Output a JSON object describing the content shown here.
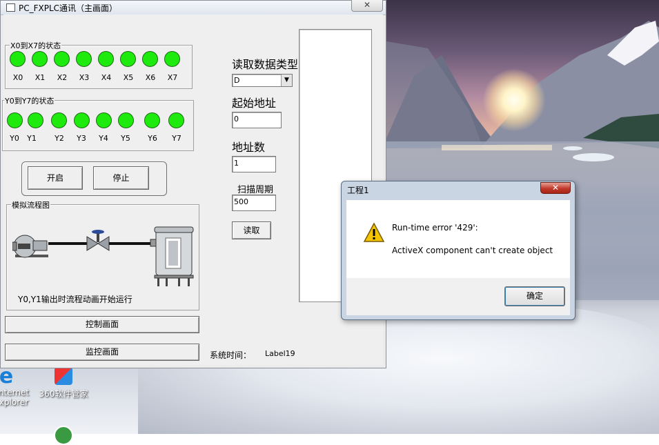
{
  "main_window": {
    "title": "PC_FXPLC通讯（主画面）",
    "close_glyph": "✕",
    "x_group": {
      "title": "X0到X7的状态",
      "labels": [
        "X0",
        "X1",
        "X2",
        "X3",
        "X4",
        "X5",
        "X6",
        "X7"
      ]
    },
    "y_group": {
      "title": "Y0到Y7的状态",
      "labels": [
        "Y0",
        "Y1",
        "Y2",
        "Y3",
        "Y4",
        "Y5",
        "Y6",
        "Y7"
      ]
    },
    "led_color": "#1eea0d",
    "start_button": "开启",
    "stop_button": "停止",
    "flow": {
      "title": "模拟流程图",
      "caption": "Y0,Y1输出时流程动画开始运行"
    },
    "control_button": "控制画面",
    "monitor_button": "监控画面",
    "read_type_label": "读取数据类型",
    "read_type_value": "D",
    "start_addr_label": "起始地址",
    "start_addr_value": "0",
    "addr_count_label": "地址数",
    "addr_count_value": "1",
    "scan_period_label": "扫描周期",
    "scan_period_value": "500",
    "read_button": "读取",
    "sys_time_label": "系统时间：",
    "sys_time_value": "Label19"
  },
  "dialog": {
    "title": "工程1",
    "close_glyph": "✕",
    "error_title": "Run-time error '429':",
    "error_message": "ActiveX component can't create object",
    "ok_button": "确定"
  },
  "desktop": {
    "icons": [
      {
        "label_line1": "nternet",
        "label_line2": "xplorer"
      },
      {
        "label_line1": "360软件管家",
        "label_line2": ""
      }
    ]
  }
}
